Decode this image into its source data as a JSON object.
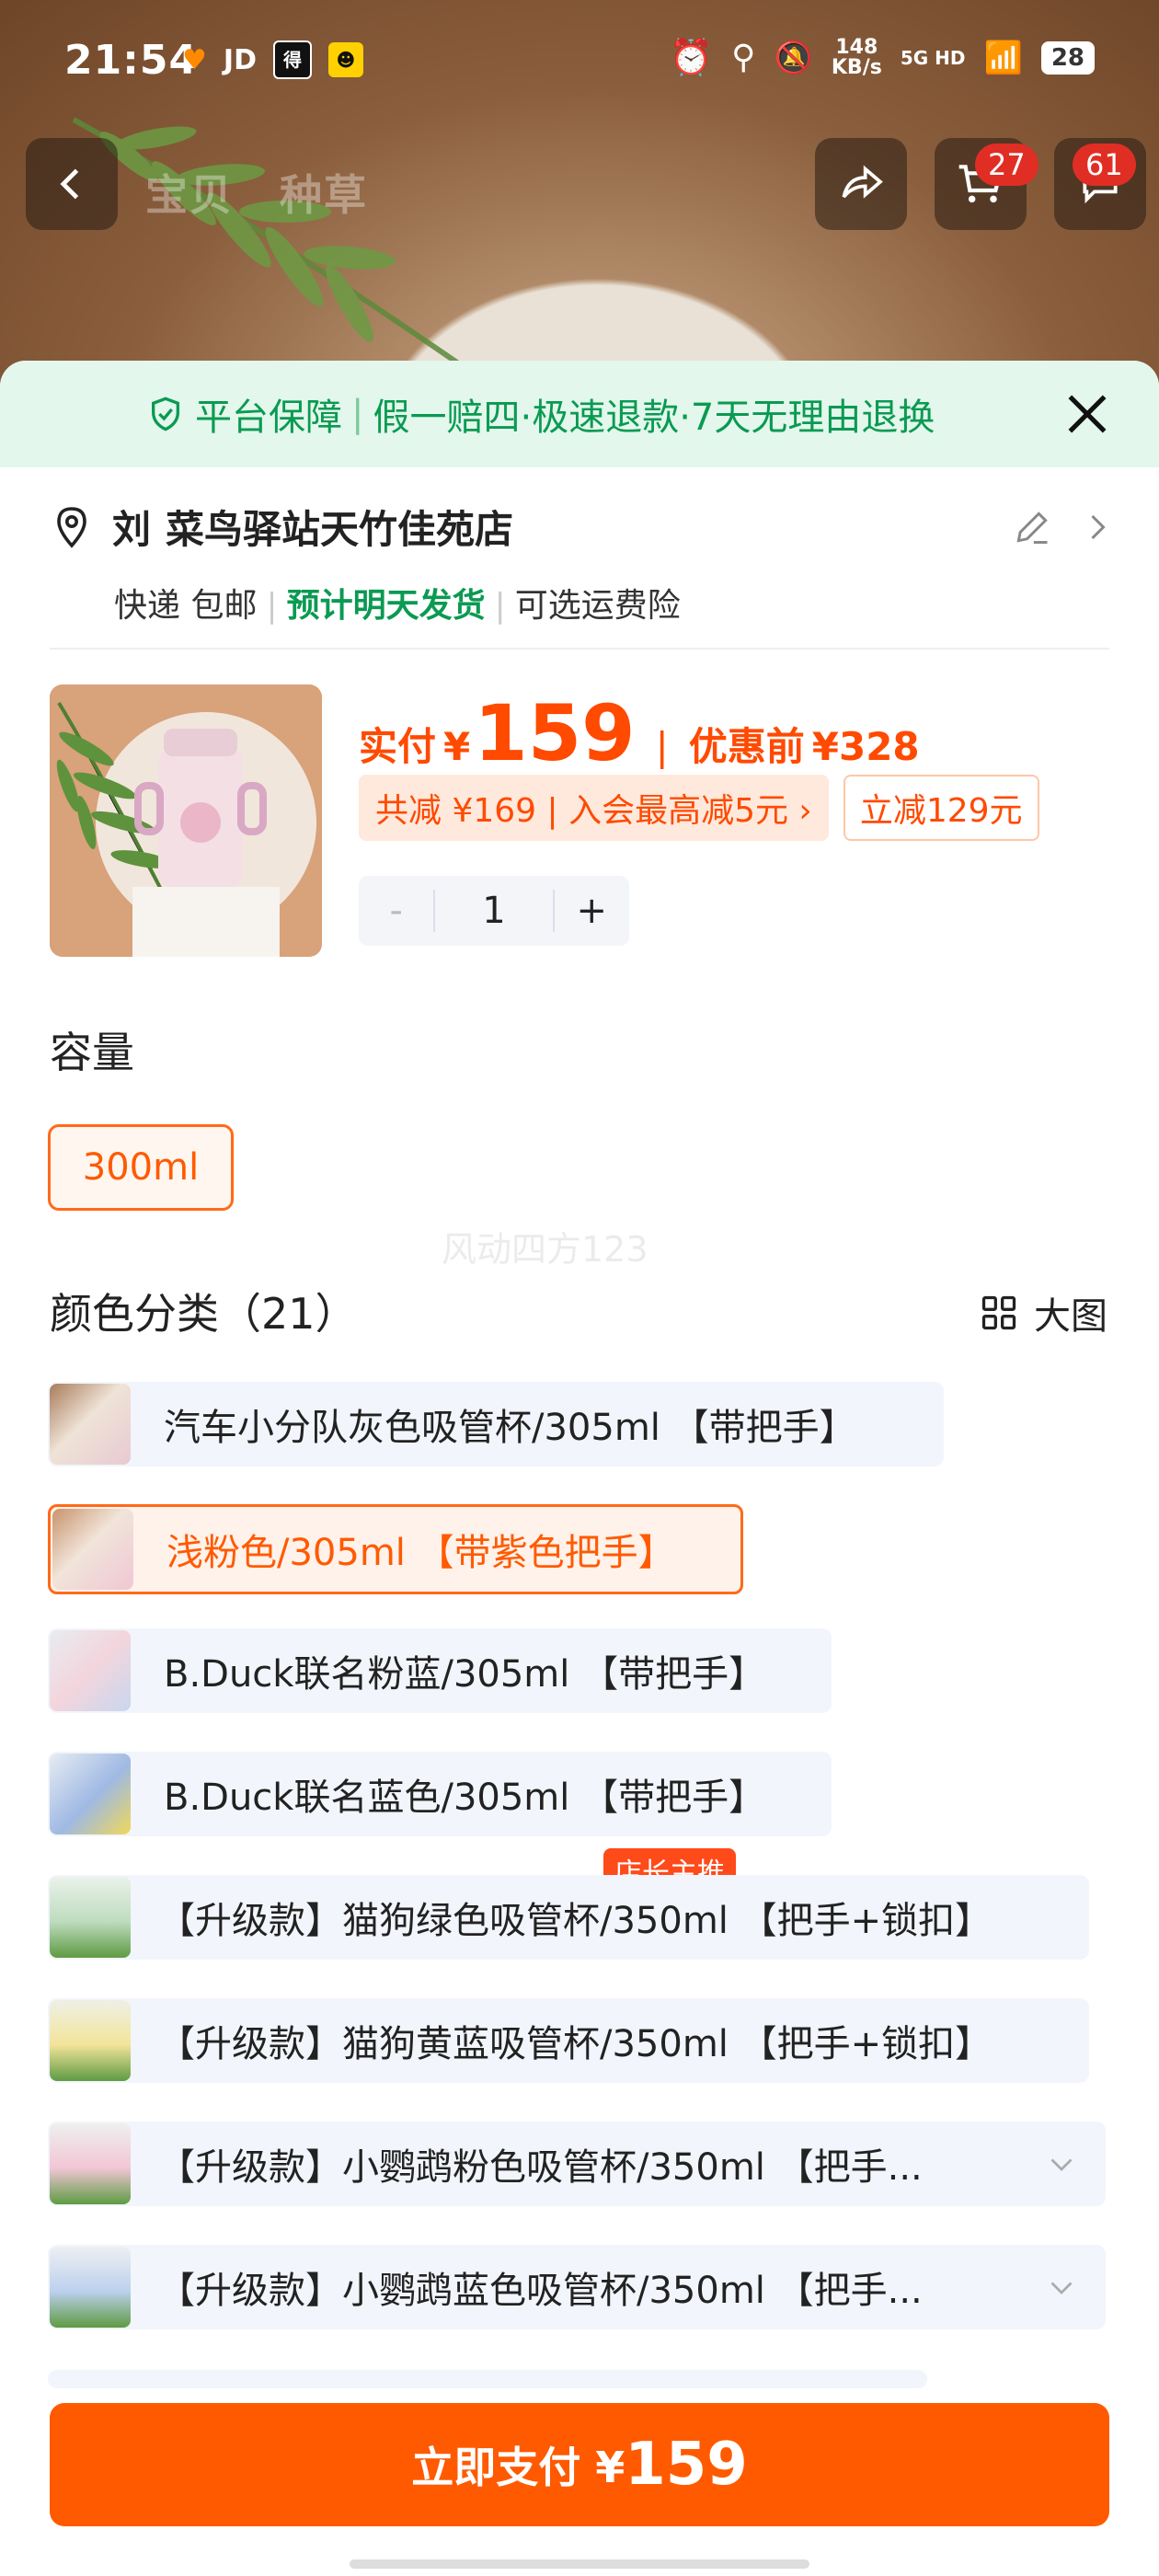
{
  "status_bar": {
    "time": "21:54",
    "apps": [
      "JD",
      "得物"
    ],
    "network_speed": "148\nKB/s",
    "signal": "5G HD",
    "battery": "28"
  },
  "nav": {
    "tabs": [
      "宝贝",
      "种草"
    ],
    "cart_badge": "27",
    "msg_badge": "61"
  },
  "guarantee": {
    "title": "平台保障",
    "sep": "|",
    "text": "假一赔四·极速退款·7天无理由退换"
  },
  "address": {
    "name": "刘",
    "location": "菜鸟驿站天竹佳苑店",
    "shipping": "快递 包邮",
    "dispatch": "预计明天发货",
    "insurance": "可选运费险"
  },
  "price": {
    "paid_label": "实付",
    "currency": "¥",
    "paid_amount": "159",
    "sep": "|",
    "before_label": "优惠前",
    "before_amount": "¥328",
    "discount_chip": "共减 ¥169 | 入会最高减5元 ›",
    "instant_chip": "立减129元"
  },
  "stepper": {
    "minus": "-",
    "qty": "1",
    "plus": "+"
  },
  "capacity": {
    "title": "容量",
    "option": "300ml"
  },
  "watermark": "风动四方123",
  "colors": {
    "title": "颜色分类（21）",
    "big_view": "大图",
    "options": [
      "汽车小分队灰色吸管杯/305ml 【带把手】",
      "浅粉色/305ml 【带紫色把手】",
      "B.Duck联名粉蓝/305ml 【带把手】",
      "B.Duck联名蓝色/305ml 【带把手】",
      "【升级款】猫狗绿色吸管杯/350ml 【把手+锁扣】",
      "【升级款】猫狗黄蓝吸管杯/350ml 【把手+锁扣】",
      "【升级款】小鹦鹉粉色吸管杯/350ml 【把手...",
      "【升级款】小鹦鹉蓝色吸管杯/350ml 【把手..."
    ],
    "selected_tag": "店长主推"
  },
  "pay_button": {
    "label": "立即支付 ¥",
    "amount": "159"
  },
  "colors_theme": {
    "accent": "#ff5a00",
    "green": "#0a9a52"
  }
}
